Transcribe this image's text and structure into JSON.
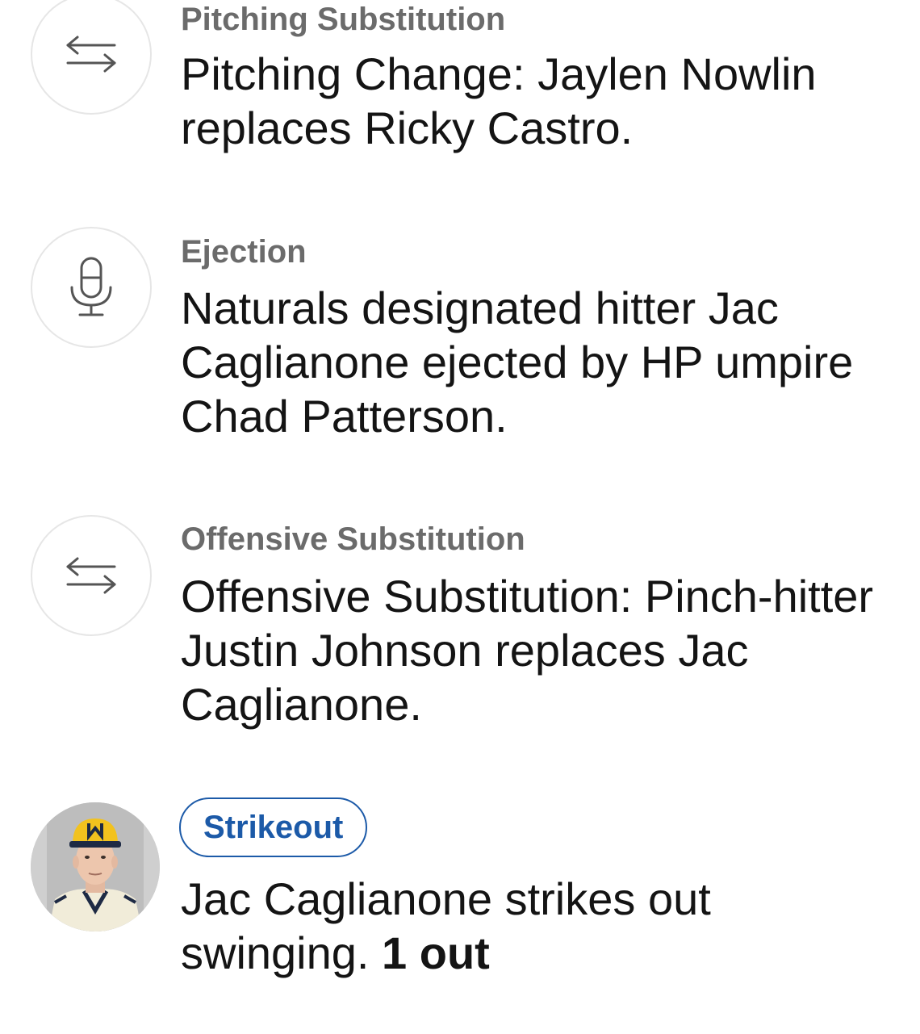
{
  "colors": {
    "type_label": "#6b6b6b",
    "description": "#141414",
    "icon_stroke": "#555555",
    "circle_border": "#e6e6e6",
    "badge_accent": "#1c5aa8"
  },
  "events": [
    {
      "icon": "swap-arrows-icon",
      "type": "Pitching Substitution",
      "description": "Pitching Change: Jaylen Nowlin replaces Ricky Castro."
    },
    {
      "icon": "microphone-icon",
      "type": "Ejection",
      "description": "Naturals designated hitter Jac Caglianone ejected by HP umpire Chad Patterson."
    },
    {
      "icon": "swap-arrows-icon",
      "type": "Offensive Substitution",
      "description": "Offensive Substitution: Pinch-hitter Justin Johnson replaces Jac Caglianone."
    },
    {
      "icon": "player-avatar",
      "type": "Strikeout",
      "description": "Jac Caglianone strikes out swinging.",
      "outs": "1 out"
    }
  ]
}
